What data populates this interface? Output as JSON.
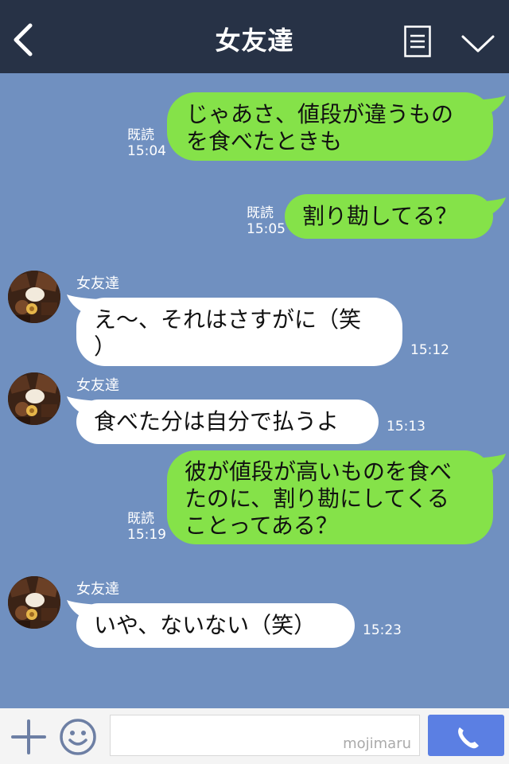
{
  "header": {
    "title": "女友達"
  },
  "messages": [
    {
      "side": "out",
      "text_lines": [
        "じゃあさ、値段が違うもの",
        "を食べたときも"
      ],
      "read": "既読",
      "time": "15:04"
    },
    {
      "side": "out",
      "text_lines": [
        "割り勘してる？"
      ],
      "read": "既読",
      "time": "15:05"
    },
    {
      "side": "in",
      "name": "女友達",
      "text_lines": [
        "え〜、それはさすがに（笑",
        "）"
      ],
      "time": "15:12"
    },
    {
      "side": "in",
      "name": "女友達",
      "text_lines": [
        "食べた分は自分で払うよ"
      ],
      "time": "15:13"
    },
    {
      "side": "out",
      "text_lines": [
        "彼が値段が高いものを食べ",
        "たのに、割り勘にしてくる",
        "ことってある？"
      ],
      "read": "既読",
      "time": "15:19"
    },
    {
      "side": "in",
      "name": "女友達",
      "text_lines": [
        "いや、ないない（笑）"
      ],
      "time": "15:23"
    }
  ],
  "footer": {
    "watermark": "mojimaru"
  },
  "icons": {
    "back": "chevron-left-icon",
    "menu": "notes-icon",
    "down": "chevron-down-icon",
    "plus": "plus-icon",
    "emoji": "smiley-icon",
    "call": "phone-icon"
  },
  "colors": {
    "header": "#273246",
    "chat_bg": "#7090c0",
    "outgoing_bubble": "#85e249",
    "incoming_bubble": "#ffffff",
    "call_button": "#5b7fe3"
  }
}
